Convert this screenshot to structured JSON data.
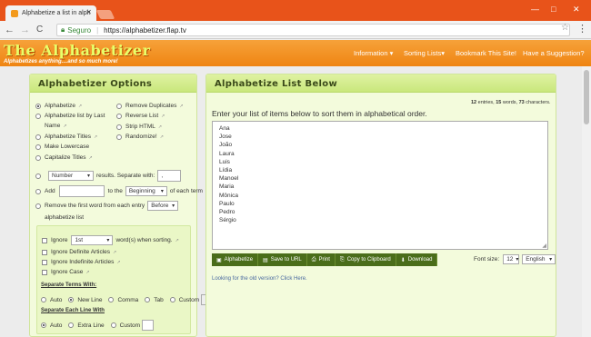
{
  "browser": {
    "tab_title": "Alphabetize a list in alph",
    "tab_close": "✕",
    "win_min": "—",
    "win_max": "□",
    "win_close": "✕",
    "back": "←",
    "forward": "→",
    "reload": "C",
    "secure_label": "Seguro",
    "url": "https://alphabetizer.flap.tv",
    "star": "☆",
    "menu": "⋮"
  },
  "site": {
    "logo": "The Alphabetizer",
    "tagline": "Alphabetizes anything....and so much more!",
    "nav": [
      "Information ▾",
      "Sorting Lists▾",
      "Bookmark This Site!",
      "Have a Suggestion?"
    ]
  },
  "options": {
    "heading": "Alphabetizer Options",
    "left_radios": [
      "Alphabetize",
      "Alphabetize list by Last",
      "Name",
      "Alphabetize Titles",
      "Make Lowercase",
      "Capitalize Titles"
    ],
    "right_radios": [
      "Remove Duplicates",
      "Reverse List",
      "Strip HTML",
      "Randomize!"
    ],
    "number_select": "Number",
    "results_label": "results. Separate with:",
    "separator_value": ",",
    "add_label": "Add",
    "to_the_label": "to the",
    "position_select": "Beginning",
    "each_term_label": "of each term",
    "remove_first_label": "Remove the first word from each entry",
    "before_select": "Before",
    "alphabetize_list_label": "alphabetize list",
    "ignore_label": "Ignore",
    "word_select": "1st",
    "word_when_label": "word(s) when sorting.",
    "ignore_checks": [
      "Ignore Definite Articles",
      "Ignore Indefinite Articles",
      "Ignore Case"
    ],
    "separate_terms_label": "Separate Terms With:",
    "separate_terms": [
      "Auto",
      "New Line",
      "Comma",
      "Tab",
      "Custom"
    ],
    "separate_lines_label": "Separate Each Line With",
    "separate_lines": [
      "Auto",
      "Extra Line",
      "Custom"
    ]
  },
  "list": {
    "heading": "Alphabetize List Below",
    "stats_entries": "12",
    "stats_entries_label": "entries,",
    "stats_words": "15",
    "stats_words_label": "words,",
    "stats_chars": "73",
    "stats_chars_label": "characters.",
    "instruction": "Enter your list of items below to sort them in alphabetical order.",
    "items": [
      "Ana",
      "Jose",
      "João",
      "Laura",
      "Luis",
      "Lídia",
      "Manoel",
      "Maria",
      "Mônica",
      "Paulo",
      "Pedro",
      "Sérgio"
    ],
    "buttons": [
      {
        "icon": "▣",
        "label": "Alphabetize"
      },
      {
        "icon": "▤",
        "label": "Save to URL"
      },
      {
        "icon": "⎙",
        "label": "Print"
      },
      {
        "icon": "⎘",
        "label": "Copy to Clipboard"
      },
      {
        "icon": "⬇",
        "label": "Download"
      }
    ],
    "font_size_label": "Font size:",
    "font_size": "12",
    "language": "English",
    "old_version": "Looking for the old version? Click Here."
  }
}
